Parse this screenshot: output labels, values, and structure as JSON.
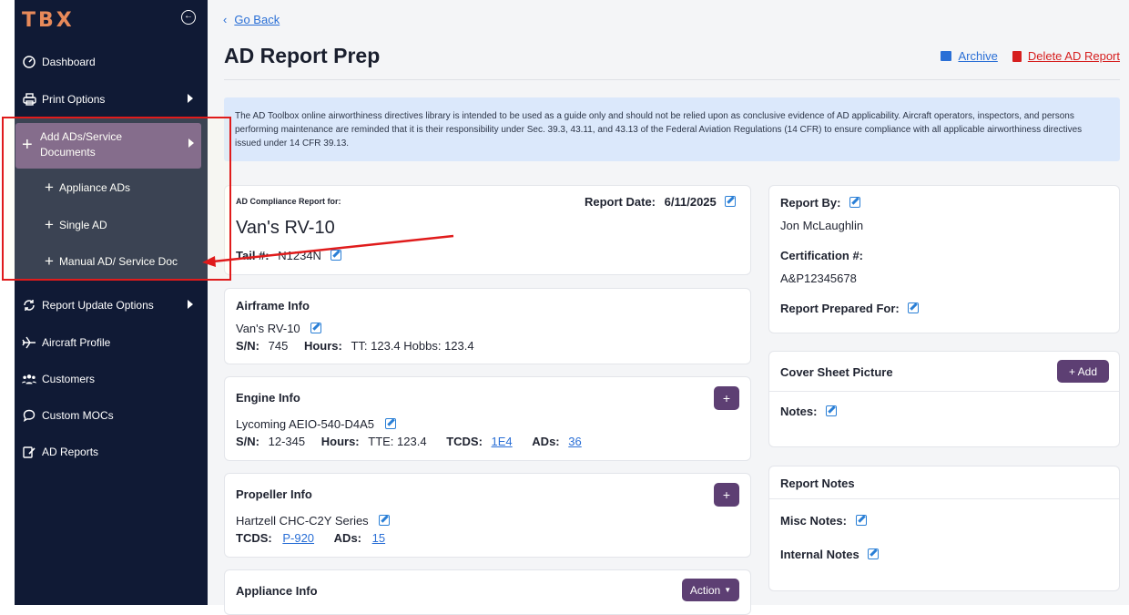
{
  "sidebar": {
    "logo": "TBX",
    "items": [
      {
        "label": "Dashboard"
      },
      {
        "label": "Print Options"
      },
      {
        "label": "Add ADs/Service Documents"
      },
      {
        "label": "Report Update Options"
      },
      {
        "label": "Aircraft Profile"
      },
      {
        "label": "Customers"
      },
      {
        "label": "Custom MOCs"
      },
      {
        "label": "AD Reports"
      }
    ],
    "sub_items": [
      {
        "label": "Appliance ADs"
      },
      {
        "label": "Single AD"
      },
      {
        "label": "Manual AD/ Service Doc"
      }
    ]
  },
  "header": {
    "go_back": "Go Back",
    "title": "AD Report Prep",
    "archive": "Archive",
    "delete": "Delete AD Report"
  },
  "banner": "The AD Toolbox online airworthiness directives library is intended to be used as a guide only and should not be relied upon as conclusive evidence of AD applicability. Aircraft operators, inspectors, and persons performing maintenance are reminded that it is their responsibility under Sec. 39.3, 43.11, and 43.13 of the Federal Aviation Regulations (14 CFR) to ensure compliance with all applicable airworthiness directives issued under 14 CFR 39.13.",
  "report": {
    "for_label": "AD Compliance Report for:",
    "aircraft": "Van's RV-10",
    "date_label": "Report Date:",
    "date": "6/11/2025",
    "tail_label": "Tail #:",
    "tail": "N1234N"
  },
  "airframe": {
    "title": "Airframe Info",
    "model": "Van's RV-10",
    "sn_label": "S/N:",
    "sn": "745",
    "hours_label": "Hours:",
    "hours": "TT: 123.4 Hobbs: 123.4"
  },
  "engine": {
    "title": "Engine Info",
    "model": "Lycoming AEIO-540-D4A5",
    "sn_label": "S/N:",
    "sn": "12-345",
    "hours_label": "Hours:",
    "hours": "TTE: 123.4",
    "tcds_label": "TCDS:",
    "tcds": "1E4",
    "ads_label": "ADs:",
    "ads": "36",
    "add_btn": "+"
  },
  "propeller": {
    "title": "Propeller Info",
    "model": "Hartzell CHC-C2Y Series",
    "tcds_label": "TCDS:",
    "tcds": "P-920",
    "ads_label": "ADs:",
    "ads": "15",
    "add_btn": "+"
  },
  "appliance": {
    "title": "Appliance Info",
    "action_btn": "Action"
  },
  "report_by": {
    "label": "Report By:",
    "name": "Jon McLaughlin",
    "cert_label": "Certification #:",
    "cert": "A&P12345678",
    "prepared_label": "Report Prepared For:"
  },
  "cover": {
    "title": "Cover Sheet Picture",
    "add_btn": "+ Add",
    "notes_label": "Notes:"
  },
  "notes": {
    "title": "Report Notes",
    "misc": "Misc Notes:",
    "internal": "Internal Notes"
  },
  "colors": {
    "sidebar": "#101a35",
    "accent_purple": "#5d3f73",
    "link": "#2a6fd6",
    "danger": "#d61f1f",
    "logo": "#e88a5a"
  }
}
